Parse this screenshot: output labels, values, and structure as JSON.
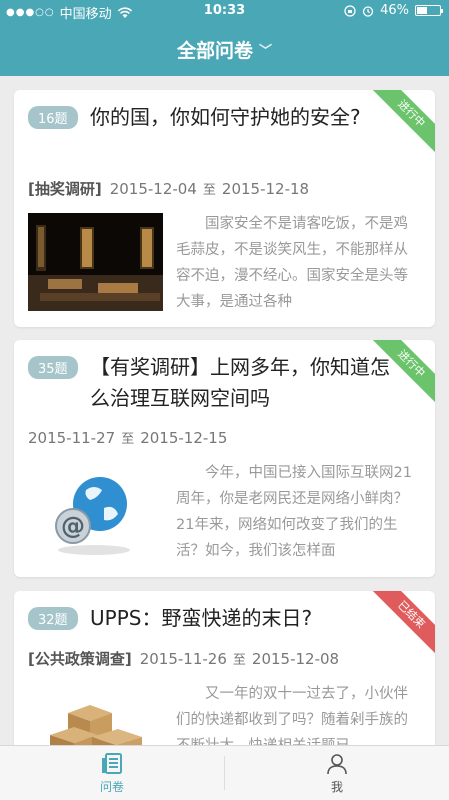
{
  "statusbar": {
    "dots": "●●●○○",
    "carrier": "中国移动",
    "time": "10:33",
    "battery": "46%",
    "battery_level": 0.46
  },
  "nav": {
    "title": "全部问卷",
    "chevron": "﹀"
  },
  "surveys": [
    {
      "count": "16题",
      "title": "你的国，你如何守护她的安全?",
      "tag": "[抽奖调研]",
      "start": "2015-12-04",
      "to": "至",
      "end": "2015-12-18",
      "summary": "国家安全不是请客吃饭，不是鸡毛蒜皮，不是谈笑风生，不能那样从容不迫，漫不经心。国家安全是头等大事，是通过各种",
      "status": "进行中",
      "status_color": "#6bc36b"
    },
    {
      "count": "35题",
      "title": "【有奖调研】上网多年，你知道怎么治理互联网空间吗",
      "tag": "",
      "start": "2015-11-27",
      "to": "至",
      "end": "2015-12-15",
      "summary": "今年，中国已接入国际互联网21周年，你是老网民还是网络小鲜肉？21年来，网络如何改变了我们的生活？如今，我们该怎样面",
      "status": "进行中",
      "status_color": "#6bc36b"
    },
    {
      "count": "32题",
      "title": "UPPS：野蛮快递的末日?",
      "tag": "[公共政策调查]",
      "start": "2015-11-26",
      "to": "至",
      "end": "2015-12-08",
      "summary": "又一年的双十一过去了，小伙伴们的快递都收到了吗？随着剁手族的不断壮大，快递相关话题已",
      "status": "已结束",
      "status_color": "#e05c5c"
    }
  ],
  "tabs": [
    {
      "label": "问卷",
      "icon": "survey-icon"
    },
    {
      "label": "我",
      "icon": "person-icon"
    }
  ],
  "colors": {
    "accent": "#4aa7b6",
    "badge": "#a6c5cb"
  }
}
